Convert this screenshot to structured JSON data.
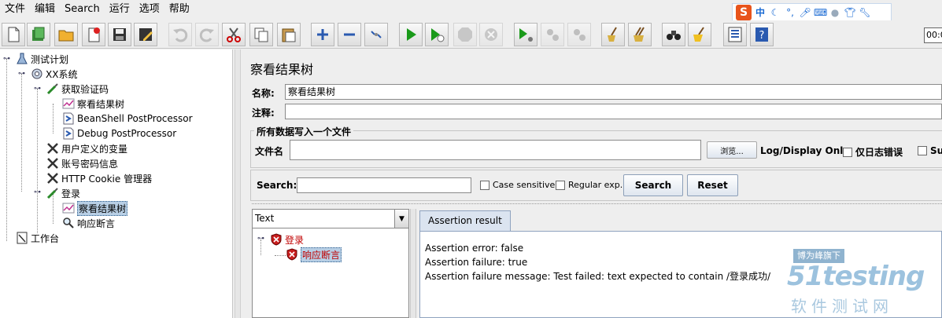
{
  "menu": [
    "文件",
    "编辑",
    "Search",
    "运行",
    "选项",
    "帮助"
  ],
  "ime": {
    "logo": "S",
    "mode": "中"
  },
  "toolbar": {
    "time_value": "00:0"
  },
  "tree": [
    {
      "label": "测试计划"
    },
    {
      "label": "XX系统"
    },
    {
      "label": "获取验证码"
    },
    {
      "label": "察看结果树"
    },
    {
      "label": "BeanShell PostProcessor"
    },
    {
      "label": "Debug PostProcessor"
    },
    {
      "label": "用户定义的变量"
    },
    {
      "label": "账号密码信息"
    },
    {
      "label": "HTTP Cookie 管理器"
    },
    {
      "label": "登录"
    },
    {
      "label": "察看结果树"
    },
    {
      "label": "响应断言"
    },
    {
      "label": "工作台"
    }
  ],
  "main": {
    "title": "察看结果树",
    "name_label": "名称:",
    "name_value": "察看结果树",
    "comment_label": "注释:",
    "comment_value": "",
    "file_group_title": "所有数据写入一个文件",
    "filename_label": "文件名",
    "filename_value": "",
    "browse_label": "浏览...",
    "log_display_label": "Log/Display Only:",
    "errors_only_label": "仅日志错误",
    "successes_label": "Su"
  },
  "search": {
    "label": "Search:",
    "value": "",
    "case_sensitive": "Case sensitive",
    "regex": "Regular exp.",
    "search_button": "Search",
    "reset_button": "Reset"
  },
  "results": {
    "renderer": "Text",
    "samples": [
      {
        "label": "登录"
      },
      {
        "label": "响应断言"
      }
    ],
    "tab": "Assertion result",
    "lines": [
      "Assertion error: false",
      "Assertion failure: true",
      "Assertion failure message: Test failed: text expected to contain /登录成功/"
    ]
  },
  "watermark": {
    "tag": "博为峰旗下",
    "brand": "51testing",
    "cn": "软件测试网"
  }
}
